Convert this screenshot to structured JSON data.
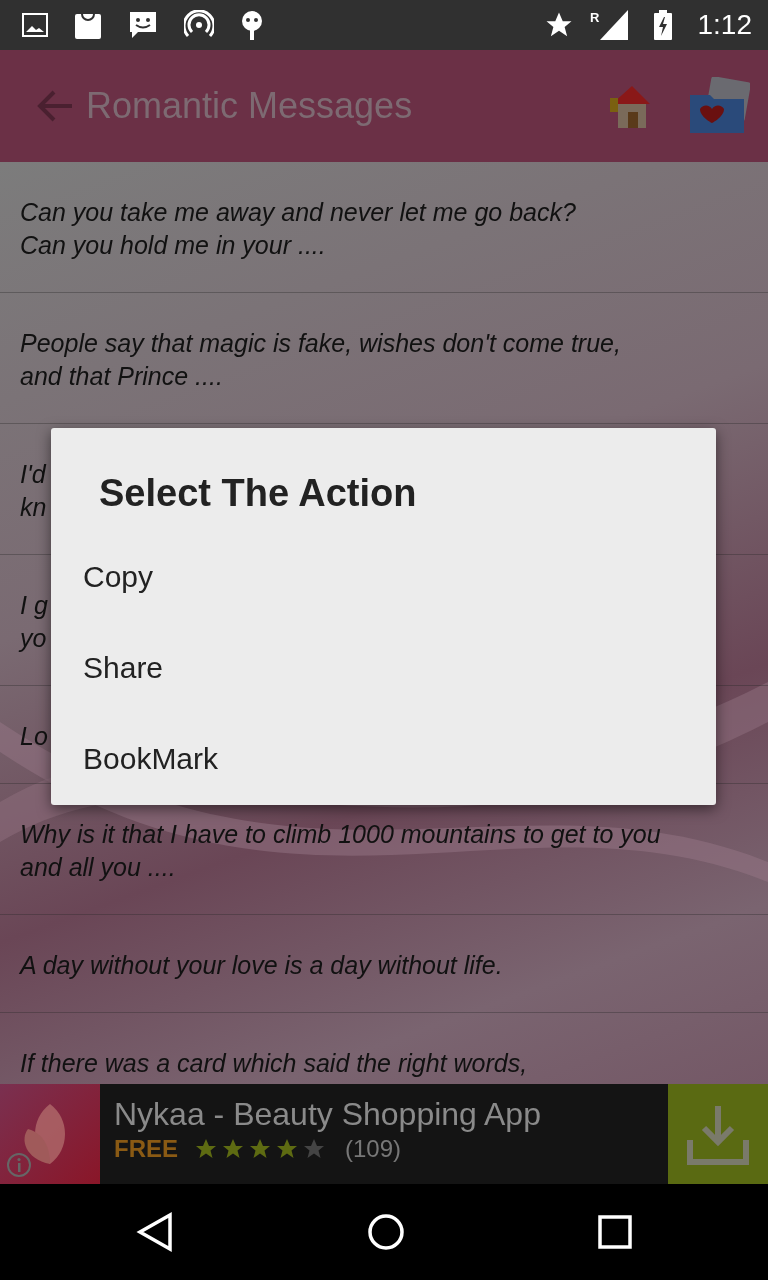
{
  "status_bar": {
    "time": "1:12",
    "roaming": "R"
  },
  "toolbar": {
    "title": "Romantic Messages"
  },
  "messages": [
    {
      "lines": [
        "Can you take me away and never let me go back?",
        "Can you hold me in your ...."
      ]
    },
    {
      "lines": [
        "People say that magic is fake, wishes don't come true,",
        "and that Prince ...."
      ]
    },
    {
      "lines": [
        "I'd",
        "kn"
      ]
    },
    {
      "lines": [
        "I g",
        "yo"
      ]
    },
    {
      "lines": [
        "Lo"
      ]
    },
    {
      "lines": [
        "Why is it that I have to climb 1000 mountains to get to you",
        "and all you ...."
      ]
    },
    {
      "lines": [
        "A day without your love is a day without life."
      ]
    },
    {
      "lines": [
        "If there was a card which said the right words,"
      ]
    }
  ],
  "dialog": {
    "title": "Select The Action",
    "options": [
      "Copy",
      "Share",
      "BookMark"
    ]
  },
  "ad": {
    "app_name": "Nykaa - Beauty Shopping App",
    "price": "FREE",
    "stars": 4,
    "reviews": "(109)"
  }
}
